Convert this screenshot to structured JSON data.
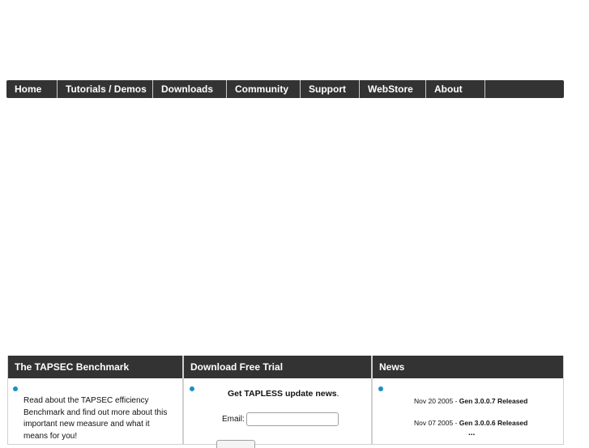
{
  "nav": {
    "items": [
      {
        "label": "Home"
      },
      {
        "label": "Tutorials / Demos"
      },
      {
        "label": "Downloads"
      },
      {
        "label": "Community"
      },
      {
        "label": "Support"
      },
      {
        "label": "WebStore"
      },
      {
        "label": "About"
      }
    ]
  },
  "panels": {
    "benchmark": {
      "title": "The TAPSEC Benchmark",
      "text": "Read about the TAPSEC efficiency Benchmark and find out more about this important new measure and what it means for you!"
    },
    "trial": {
      "title": "Download Free Trial",
      "heading_bold": "Get TAPLESS update news",
      "heading_tail": ".",
      "email_label": "Email:",
      "email_value": ""
    },
    "news": {
      "title": "News",
      "items": [
        {
          "date": "Nov 20 2005 - ",
          "headline": "Gen 3.0.0.7 Released"
        },
        {
          "date": "Nov 07 2005 - ",
          "headline": "Gen 3.0.0.6 Released"
        }
      ],
      "more": "..."
    }
  },
  "colors": {
    "bar_background": "#333333",
    "bullet_accent": "#1a8fc9"
  }
}
